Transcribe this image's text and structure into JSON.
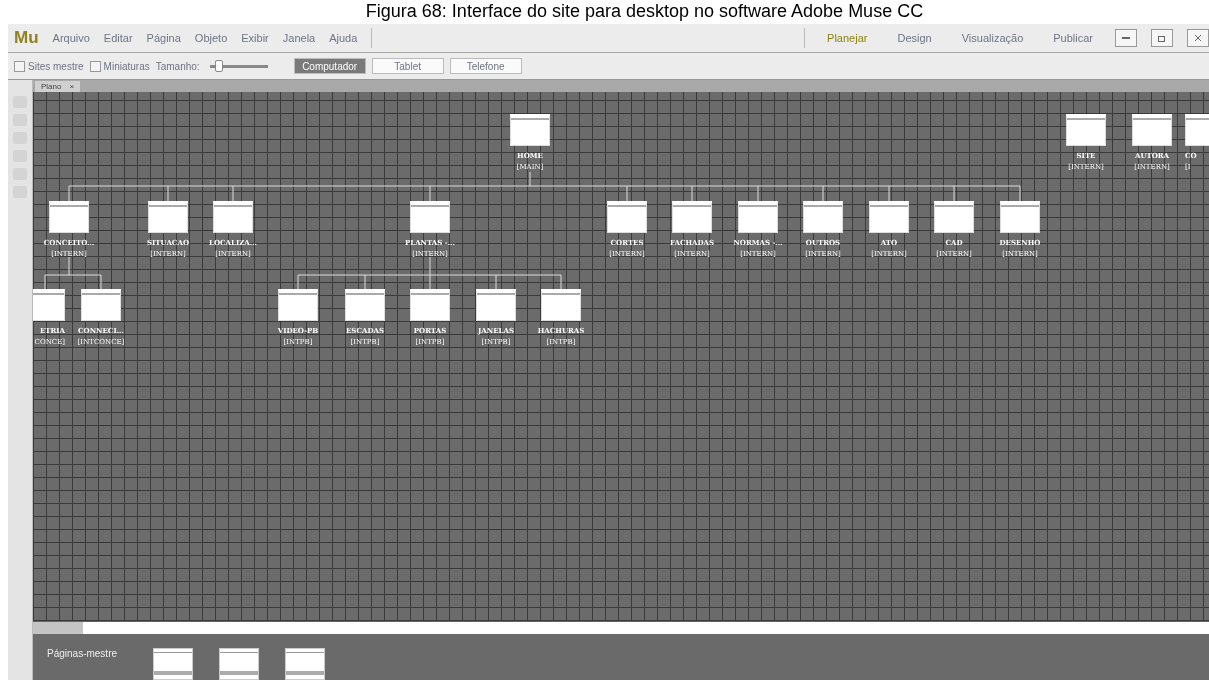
{
  "caption": "Figura 68: Interface do site para desktop no software Adobe Muse CC",
  "app": {
    "logo": "Mu",
    "menu": [
      "Arquivo",
      "Editar",
      "Página",
      "Objeto",
      "Exibir",
      "Janela",
      "Ajuda"
    ],
    "modes": [
      {
        "label": "Planejar",
        "selected": true
      },
      {
        "label": "Design",
        "selected": false
      },
      {
        "label": "Visualização",
        "selected": false
      },
      {
        "label": "Publicar",
        "selected": false
      }
    ]
  },
  "toolbar": {
    "checks": [
      {
        "label": "Sites mestre",
        "checked": false
      },
      {
        "label": "Miniaturas",
        "checked": false
      }
    ],
    "size_label": "Tamanho:",
    "size_slider": {
      "level": 0.1
    },
    "devices": [
      {
        "label": "Computador",
        "selected": true
      },
      {
        "label": "Tablet",
        "selected": false
      },
      {
        "label": "Telefone",
        "selected": false
      }
    ]
  },
  "document_tab": {
    "label": "Plano",
    "close": "×"
  },
  "sitemap": {
    "nodes": [
      {
        "name": "HOME",
        "master": "[MAIN]",
        "children": [
          {
            "name": "CONCEITO...",
            "master": "[INTERN]",
            "children": [
              {
                "name": "ETRIA",
                "master": "CONCE]"
              },
              {
                "name": "CONNECI...",
                "master": "[INTCONCE]"
              }
            ]
          },
          {
            "name": "SITUACAO",
            "master": "[INTERN]"
          },
          {
            "name": "LOCALIZA...",
            "master": "[INTERN]"
          },
          {
            "name": "PLANTAS -...",
            "master": "[INTERN]",
            "children": [
              {
                "name": "VIDEO-PB",
                "master": "[INTPB]"
              },
              {
                "name": "ESCADAS",
                "master": "[INTPB]"
              },
              {
                "name": "PORTAS",
                "master": "[INTPB]"
              },
              {
                "name": "JANELAS",
                "master": "[INTPB]"
              },
              {
                "name": "HACHURAS",
                "master": "[INTPB]"
              }
            ]
          },
          {
            "name": "CORTES",
            "master": "[INTERN]"
          },
          {
            "name": "FACHADAS",
            "master": "[INTERN]"
          },
          {
            "name": "NORMAS -...",
            "master": "[INTERN]"
          },
          {
            "name": "OUTROS",
            "master": "[INTERN]"
          },
          {
            "name": "ATO",
            "master": "[INTERN]"
          },
          {
            "name": "CAD",
            "master": "[INTERN]"
          },
          {
            "name": "DESENHO",
            "master": "[INTERN]"
          }
        ]
      },
      {
        "name": "SITE",
        "master": "[INTERN]"
      },
      {
        "name": "AUTORA",
        "master": "[INTERN]"
      },
      {
        "name": "CO",
        "master": "[I"
      }
    ]
  },
  "masters": {
    "title": "Páginas-mestre"
  }
}
